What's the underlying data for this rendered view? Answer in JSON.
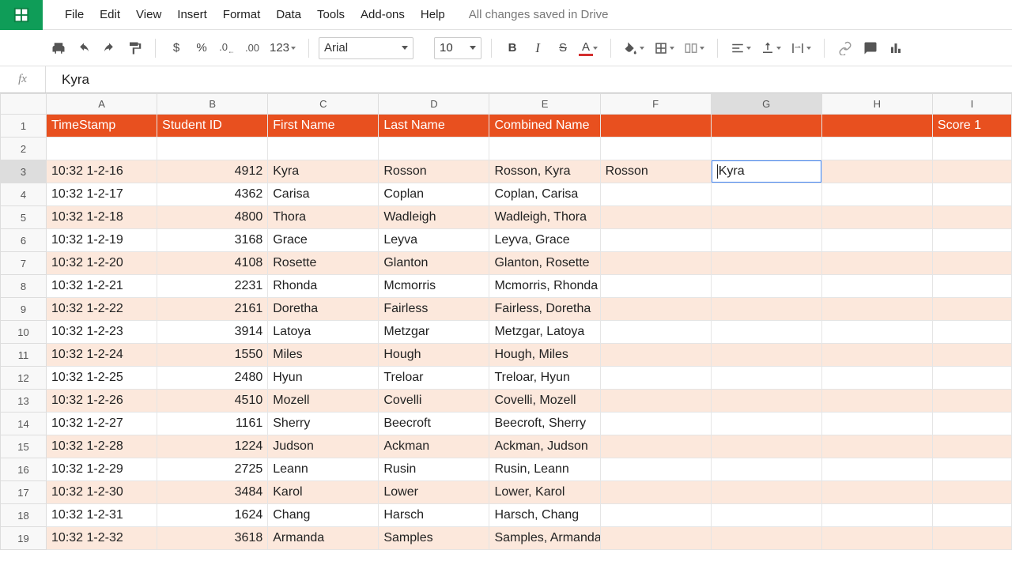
{
  "menu": {
    "items": [
      "File",
      "Edit",
      "View",
      "Insert",
      "Format",
      "Data",
      "Tools",
      "Add-ons",
      "Help"
    ],
    "status": "All changes saved in Drive"
  },
  "toolbar": {
    "currency": "$",
    "percent": "%",
    "dec_dec": ".0",
    "dec_label_left": ".0",
    "dec_label_right": ".00",
    "num_fmt": "123",
    "font": "Arial",
    "size": "10",
    "bold": "B",
    "italic": "I",
    "strike": "S",
    "textcolor": "A"
  },
  "formula": {
    "fx": "fx",
    "value": "Kyra"
  },
  "columns": [
    "A",
    "B",
    "C",
    "D",
    "E",
    "F",
    "G",
    "H",
    "I"
  ],
  "active": {
    "col": "G",
    "row": 3,
    "value": "Kyra"
  },
  "headerRow": {
    "A": "TimeStamp",
    "B": "Student ID",
    "C": "First Name",
    "D": "Last Name",
    "E": "Combined Name",
    "F": "",
    "G": "",
    "H": "",
    "I": "Score 1"
  },
  "rows": [
    {
      "n": 2
    },
    {
      "n": 3,
      "band": true,
      "A": "10:32 1-2-16",
      "B": "4912",
      "C": "Kyra",
      "D": "Rosson",
      "E": "Rosson, Kyra",
      "F": "Rosson",
      "G": "Kyra"
    },
    {
      "n": 4,
      "A": "10:32 1-2-17",
      "B": "4362",
      "C": "Carisa",
      "D": "Coplan",
      "E": "Coplan, Carisa"
    },
    {
      "n": 5,
      "band": true,
      "A": "10:32 1-2-18",
      "B": "4800",
      "C": "Thora",
      "D": "Wadleigh",
      "E": "Wadleigh, Thora"
    },
    {
      "n": 6,
      "A": "10:32 1-2-19",
      "B": "3168",
      "C": "Grace",
      "D": "Leyva",
      "E": "Leyva, Grace"
    },
    {
      "n": 7,
      "band": true,
      "A": "10:32 1-2-20",
      "B": "4108",
      "C": "Rosette",
      "D": "Glanton",
      "E": "Glanton, Rosette"
    },
    {
      "n": 8,
      "A": "10:32 1-2-21",
      "B": "2231",
      "C": "Rhonda",
      "D": "Mcmorris",
      "E": "Mcmorris, Rhonda"
    },
    {
      "n": 9,
      "band": true,
      "A": "10:32 1-2-22",
      "B": "2161",
      "C": "Doretha",
      "D": "Fairless",
      "E": "Fairless, Doretha"
    },
    {
      "n": 10,
      "A": "10:32 1-2-23",
      "B": "3914",
      "C": "Latoya",
      "D": "Metzgar",
      "E": "Metzgar, Latoya"
    },
    {
      "n": 11,
      "band": true,
      "A": "10:32 1-2-24",
      "B": "1550",
      "C": "Miles",
      "D": "Hough",
      "E": "Hough, Miles"
    },
    {
      "n": 12,
      "A": "10:32 1-2-25",
      "B": "2480",
      "C": "Hyun",
      "D": "Treloar",
      "E": "Treloar, Hyun"
    },
    {
      "n": 13,
      "band": true,
      "A": "10:32 1-2-26",
      "B": "4510",
      "C": "Mozell",
      "D": "Covelli",
      "E": "Covelli, Mozell"
    },
    {
      "n": 14,
      "A": "10:32 1-2-27",
      "B": "1161",
      "C": "Sherry",
      "D": "Beecroft",
      "E": "Beecroft, Sherry"
    },
    {
      "n": 15,
      "band": true,
      "A": "10:32 1-2-28",
      "B": "1224",
      "C": "Judson",
      "D": "Ackman",
      "E": "Ackman, Judson"
    },
    {
      "n": 16,
      "A": "10:32 1-2-29",
      "B": "2725",
      "C": "Leann",
      "D": "Rusin",
      "E": "Rusin, Leann"
    },
    {
      "n": 17,
      "band": true,
      "A": "10:32 1-2-30",
      "B": "3484",
      "C": "Karol",
      "D": "Lower",
      "E": "Lower, Karol"
    },
    {
      "n": 18,
      "A": "10:32 1-2-31",
      "B": "1624",
      "C": "Chang",
      "D": "Harsch",
      "E": "Harsch, Chang"
    },
    {
      "n": 19,
      "band": true,
      "A": "10:32 1-2-32",
      "B": "3618",
      "C": "Armanda",
      "D": "Samples",
      "E": "Samples, Armanda"
    }
  ]
}
